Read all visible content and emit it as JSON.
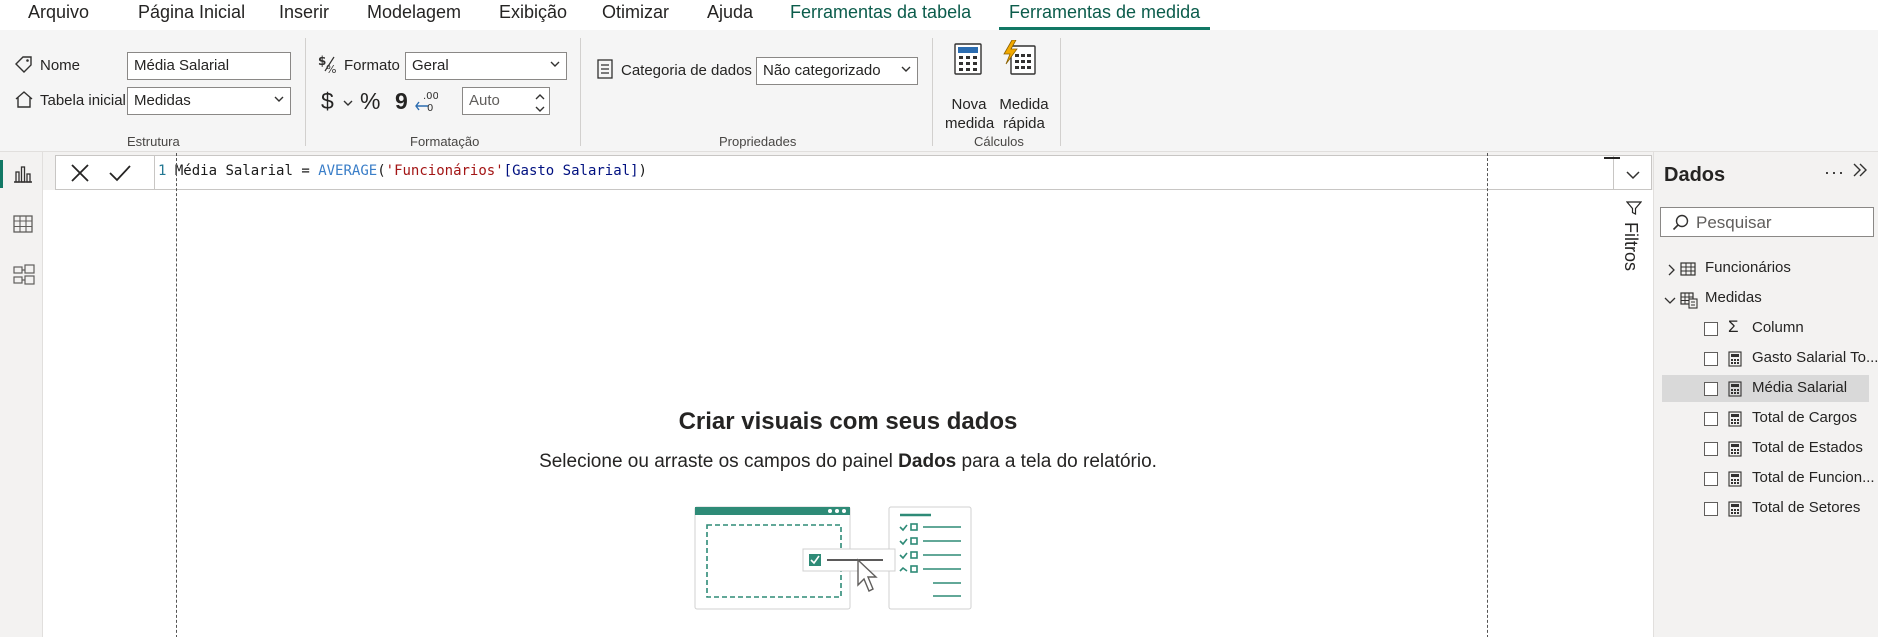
{
  "menu": {
    "items": [
      "Arquivo",
      "Página Inicial",
      "Inserir",
      "Modelagem",
      "Exibição",
      "Otimizar",
      "Ajuda"
    ],
    "context_tabs": [
      "Ferramentas da tabela",
      "Ferramentas de medida"
    ],
    "active_tab": "Ferramentas de medida"
  },
  "ribbon": {
    "estrutura": {
      "name_label": "Nome",
      "name_value": "Média Salarial",
      "home_table_label": "Tabela inicial",
      "home_table_value": "Medidas",
      "title": "Estrutura"
    },
    "formatacao": {
      "format_label": "Formato",
      "format_value": "Geral",
      "currency_symbol": "$",
      "percent_symbol": "%",
      "comma_symbol": "9",
      "decimal_value": "Auto",
      "title": "Formatação"
    },
    "propriedades": {
      "category_label": "Categoria de dados",
      "category_value": "Não categorizado",
      "title": "Propriedades"
    },
    "calculos": {
      "new_measure_line1": "Nova",
      "new_measure_line2": "medida",
      "quick_measure_line1": "Medida",
      "quick_measure_line2": "rápida",
      "title": "Cálculos"
    }
  },
  "formula": {
    "line_number": "1",
    "measure_name": "Média Salarial",
    "operator": " = ",
    "function": "AVERAGE",
    "open": "(",
    "table_ref": "'Funcionários'",
    "column_ref": "[Gasto Salarial]",
    "close": ")"
  },
  "canvas": {
    "empty_title": "Criar visuais com seus dados",
    "empty_sub_before": "Selecione ou arraste os campos do painel ",
    "empty_sub_bold": "Dados",
    "empty_sub_after": " para a tela do relatório."
  },
  "filters": {
    "label": "Filtros"
  },
  "data_pane": {
    "title": "Dados",
    "more": "···",
    "search_placeholder": "Pesquisar",
    "tables": [
      {
        "name": "Funcionários",
        "expanded": false
      },
      {
        "name": "Medidas",
        "expanded": true
      }
    ],
    "measures": [
      {
        "name": "Column",
        "icon": "sigma-icon",
        "selected": false
      },
      {
        "name": "Gasto Salarial To...",
        "icon": "calculator-icon",
        "selected": false
      },
      {
        "name": "Média Salarial",
        "icon": "calculator-icon",
        "selected": true
      },
      {
        "name": "Total de Cargos",
        "icon": "calculator-icon",
        "selected": false
      },
      {
        "name": "Total de Estados",
        "icon": "calculator-icon",
        "selected": false
      },
      {
        "name": "Total de Funcion...",
        "icon": "calculator-icon",
        "selected": false
      },
      {
        "name": "Total de Setores",
        "icon": "calculator-icon",
        "selected": false
      }
    ]
  },
  "colors": {
    "accent": "#117865",
    "ribbon_bg": "#f5f5f5",
    "selected_row": "#d9d9d9"
  }
}
